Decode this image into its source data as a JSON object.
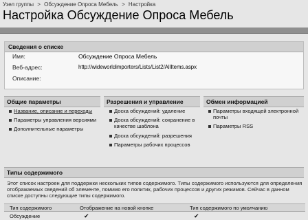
{
  "breadcrumb": {
    "items": [
      "Узел группы",
      "Обсуждение Опроса Мебель",
      "Настройка"
    ],
    "separator": ">"
  },
  "page": {
    "title": "Настройка Обсуждение Опроса Мебель"
  },
  "list_info": {
    "heading": "Сведения о списке",
    "name_label": "Имя:",
    "name_value": "Обсуждение Опроса Мебель",
    "url_label": "Веб-адрес:",
    "url_value": "http://wideworldimporters/Lists/List2/AllItems.aspx",
    "description_label": "Описание:"
  },
  "sections": [
    {
      "heading": "Общие параметры",
      "links": [
        "Название, описание и переходы",
        "Параметры управления версиями",
        "Дополнительные параметры"
      ]
    },
    {
      "heading": "Разрешения и управление",
      "links": [
        "Доска обсуждений: удаление",
        "Доска обсуждений: сохранение в качестве шаблона",
        "Доска обсуждений: разрешения",
        "Параметры рабочих процессов"
      ]
    },
    {
      "heading": "Обмен информацией",
      "links": [
        "Параметры входящей электронной почты",
        "Параметры RSS"
      ]
    }
  ],
  "content_types": {
    "heading": "Типы содержимого",
    "description": "Этот список настроен для поддержки нескольких типов содержимого. Типы содержимого используются для определения отображаемых сведений об элементе, помимо его политик, рабочих процессов и других режимов. Сейчас в данном списке доступны следующие типы содержимого.",
    "columns": [
      "Тип содержимого",
      "Отображение на новой кнопке",
      "Тип содержимого по умолчанию"
    ],
    "rows": [
      {
        "name": "Обсуждение",
        "visible_on_new": "✔",
        "is_default": "✔"
      }
    ]
  }
}
